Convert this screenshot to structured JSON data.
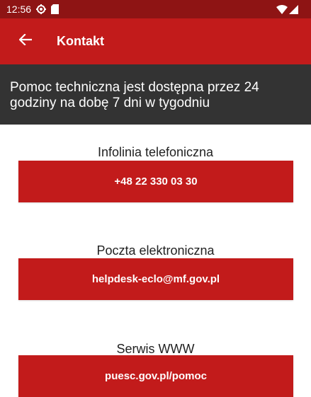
{
  "status_bar": {
    "time": "12:56",
    "icons": [
      "settings-icon",
      "sd-card-icon",
      "wifi-icon",
      "signal-icon"
    ]
  },
  "app_bar": {
    "title": "Kontakt",
    "back_icon": "arrow-left-icon"
  },
  "banner": {
    "text": "Pomoc techniczna jest dostępna przez 24 godziny na dobę 7 dni w tygodniu"
  },
  "contacts": [
    {
      "label": "Infolinia telefoniczna",
      "value": "+48 22 330 03 30"
    },
    {
      "label": "Poczta elektroniczna",
      "value": "helpdesk-eclo@mf.gov.pl"
    },
    {
      "label": "Serwis WWW",
      "value": "puesc.gov.pl/pomoc"
    }
  ],
  "colors": {
    "status_bar": "#8e1414",
    "primary": "#c21b1b",
    "banner": "#333333",
    "text_dark": "#222222"
  }
}
